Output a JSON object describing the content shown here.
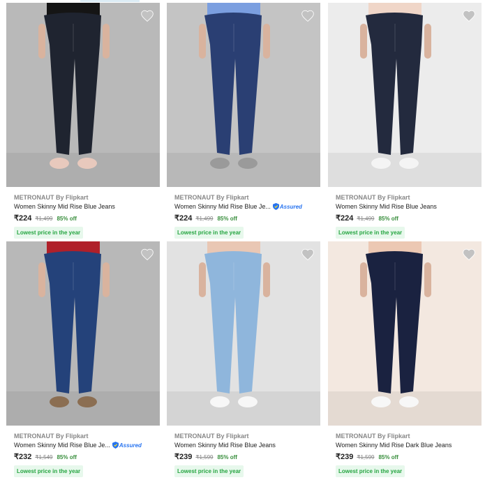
{
  "products": [
    {
      "brand": "METRONAUT By Flipkart",
      "title": "Women Skinny Mid Rise Blue Jeans",
      "price": "₹224",
      "mrp": "₹1,499",
      "discount": "85% off",
      "tag": "Lowest price in the year",
      "assured": false,
      "bg": "#b9b9b9",
      "jean": "#1f2430",
      "top": "#151515",
      "shoe": "#e8c9bd"
    },
    {
      "brand": "METRONAUT By Flipkart",
      "title": "Women Skinny Mid Rise Blue Je...",
      "price": "₹224",
      "mrp": "₹1,499",
      "discount": "85% off",
      "tag": "Lowest price in the year",
      "assured": true,
      "assured_label": "Assured",
      "bg": "#c4c4c4",
      "jean": "#2a3f73",
      "top": "#7b9fe0",
      "shoe": "#9a9a9a"
    },
    {
      "brand": "METRONAUT By Flipkart",
      "title": "Women Skinny Mid Rise Blue Jeans",
      "price": "₹224",
      "mrp": "₹1,499",
      "discount": "85% off",
      "tag": "Lowest price in the year",
      "assured": false,
      "bg": "#ececec",
      "jean": "#232a3e",
      "top": "#f0d6c8",
      "shoe": "#f4f4f4"
    },
    {
      "brand": "METRONAUT By Flipkart",
      "title": "Women Skinny Mid Rise Blue Je...",
      "price": "₹232",
      "mrp": "₹1,549",
      "discount": "85% off",
      "tag": "Lowest price in the year",
      "assured": true,
      "assured_label": "Assured",
      "bg": "#b8b8b8",
      "jean": "#24427a",
      "top": "#b0202a",
      "shoe": "#8b6e52"
    },
    {
      "brand": "METRONAUT By Flipkart",
      "title": "Women Skinny Mid Rise Blue Jeans",
      "price": "₹239",
      "mrp": "₹1,599",
      "discount": "85% off",
      "tag": "Lowest price in the year",
      "assured": false,
      "bg": "#e2e2e2",
      "jean": "#8fb6dc",
      "top": "#e9c7b4",
      "shoe": "#f7f7f7"
    },
    {
      "brand": "METRONAUT By Flipkart",
      "title": "Women Skinny Mid Rise Dark Blue Jeans",
      "price": "₹239",
      "mrp": "₹1,599",
      "discount": "85% off",
      "tag": "Lowest price in the year",
      "assured": false,
      "bg": "#f3e8e0",
      "jean": "#1a2240",
      "top": "#ecc8b3",
      "shoe": "#f7f7f7"
    }
  ],
  "icons": {
    "wishlist": "heart-icon",
    "assured": "shield-icon"
  }
}
